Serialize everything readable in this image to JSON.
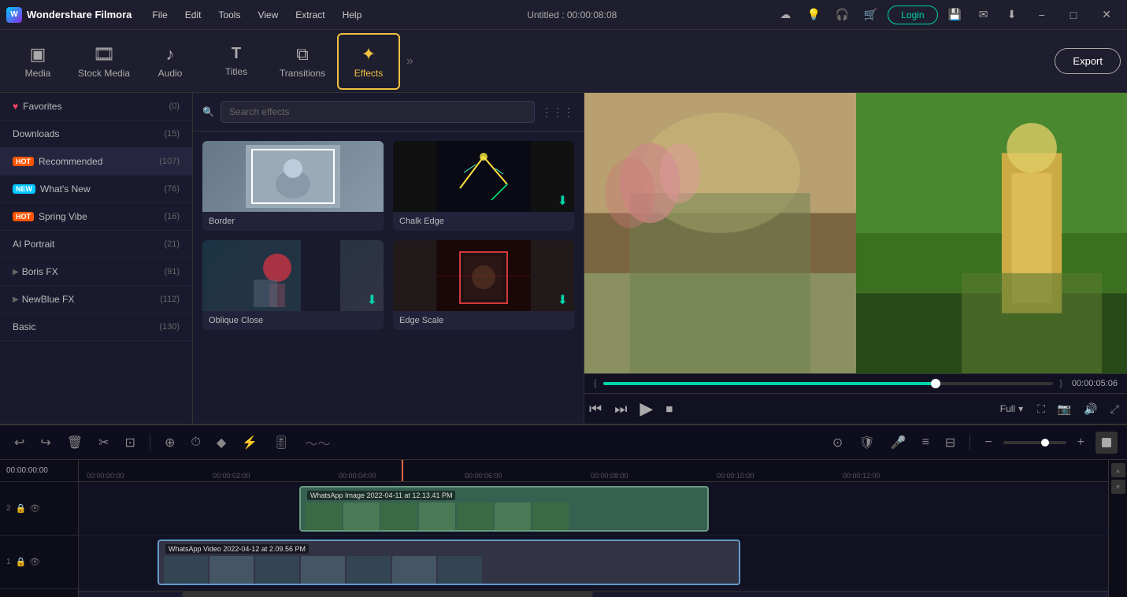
{
  "titlebar": {
    "logo_text": "Wondershare Filmora",
    "menu_items": [
      "File",
      "Edit",
      "Tools",
      "View",
      "Extract",
      "Help"
    ],
    "title": "Untitled : 00:00:08:08",
    "login_label": "Login"
  },
  "toolbar": {
    "items": [
      {
        "id": "media",
        "label": "Media",
        "icon": "▣"
      },
      {
        "id": "stock",
        "label": "Stock Media",
        "icon": "🎞"
      },
      {
        "id": "audio",
        "label": "Audio",
        "icon": "♪"
      },
      {
        "id": "titles",
        "label": "Titles",
        "icon": "T"
      },
      {
        "id": "transitions",
        "label": "Transitions",
        "icon": "⧉"
      },
      {
        "id": "effects",
        "label": "Effects",
        "icon": "✦"
      }
    ],
    "export_label": "Export"
  },
  "left_panel": {
    "items": [
      {
        "id": "favorites",
        "label": "Favorites",
        "count": "(0)",
        "badge": null,
        "heart": true
      },
      {
        "id": "downloads",
        "label": "Downloads",
        "count": "(15)",
        "badge": null
      },
      {
        "id": "recommended",
        "label": "Recommended",
        "count": "(107)",
        "badge": "HOT"
      },
      {
        "id": "whats_new",
        "label": "What's New",
        "count": "(76)",
        "badge": "NEW"
      },
      {
        "id": "spring_vibe",
        "label": "Spring Vibe",
        "count": "(16)",
        "badge": "HOT"
      },
      {
        "id": "ai_portrait",
        "label": "AI Portrait",
        "count": "(21)",
        "badge": null
      },
      {
        "id": "boris_fx",
        "label": "Boris FX",
        "count": "(91)",
        "badge": null,
        "expand": true
      },
      {
        "id": "newblue_fx",
        "label": "NewBlue FX",
        "count": "(112)",
        "badge": null,
        "expand": true
      },
      {
        "id": "basic",
        "label": "Basic",
        "count": "(130)",
        "badge": null
      }
    ]
  },
  "effects_panel": {
    "search_placeholder": "Search effects",
    "effects": [
      {
        "id": "border",
        "name": "Border"
      },
      {
        "id": "chalk_edge",
        "name": "Chalk Edge"
      },
      {
        "id": "oblique_close",
        "name": "Oblique Close"
      },
      {
        "id": "edge_scale",
        "name": "Edge Scale"
      }
    ]
  },
  "preview": {
    "time_current": "00:00:05:06",
    "quality": "Full",
    "progress_percent": 75
  },
  "timeline": {
    "current_time": "00:00:00:00",
    "ruler_marks": [
      "00:00:00:00",
      "00:00:02:00",
      "00:00:04:00",
      "00:00:06:00",
      "00:00:08:00",
      "00:00:10:00",
      "00:00:12:00"
    ],
    "tracks": [
      {
        "id": "track2",
        "label": "2",
        "clip_label": "WhatsApp Image 2022-04-11 at 12.13.41 PM"
      },
      {
        "id": "track1",
        "label": "1",
        "clip_label": "WhatsApp Video 2022-04-12 at 2.09.56 PM"
      }
    ]
  }
}
